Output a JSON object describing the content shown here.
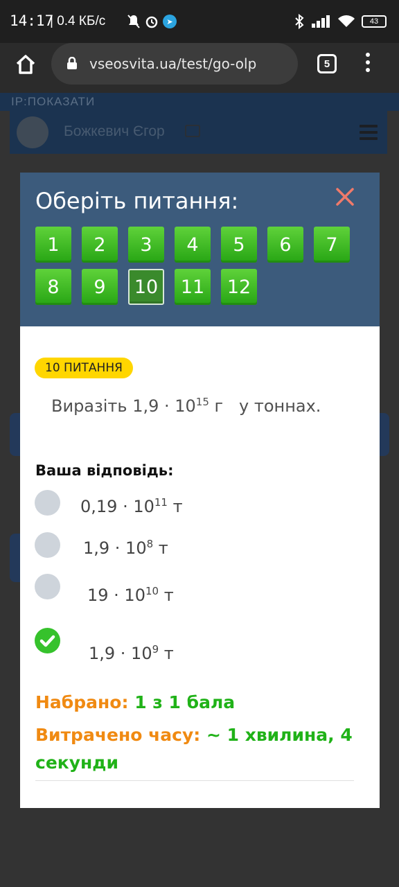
{
  "status_bar": {
    "time": "14:17",
    "net_speed": "| 0.4 КБ/с",
    "battery": "43"
  },
  "browser": {
    "url": "vseosvita.ua/test/go-olp",
    "tab_count": "5"
  },
  "page": {
    "ip_label": "IP:ПОКАЗАТИ",
    "user_name": "Божкевич Єгор"
  },
  "modal": {
    "title": "Оберіть питання:",
    "question_numbers": [
      "1",
      "2",
      "3",
      "4",
      "5",
      "6",
      "7",
      "8",
      "9",
      "10",
      "11",
      "12"
    ],
    "active_question": "10",
    "badge": "10 ПИТАННЯ",
    "question": {
      "prefix": "Виразіть 1,9 · 10",
      "exp": "15",
      "suffix": " г   у тоннах."
    },
    "answer_label": "Ваша відповідь:",
    "options": [
      {
        "base": "0,19 · 10",
        "exp": "11",
        "unit": " т",
        "selected": false
      },
      {
        "base": "1,9 · 10",
        "exp": "8",
        "unit": " т",
        "selected": false
      },
      {
        "base": "19 · 10",
        "exp": "10",
        "unit": " т",
        "selected": false
      },
      {
        "base": "1,9 · 10",
        "exp": "9",
        "unit": " т",
        "selected": true
      }
    ],
    "score_label": "Набрано:",
    "score_value": "1 з 1 бала",
    "time_label": "Витрачено часу:",
    "time_value": "~ 1 хвилина, 4 секунди"
  },
  "colors": {
    "modal_header": "#3c5b7c",
    "question_button": "#27a514",
    "badge": "#ffd600",
    "label_orange": "#f08a12",
    "value_green": "#20b218"
  }
}
